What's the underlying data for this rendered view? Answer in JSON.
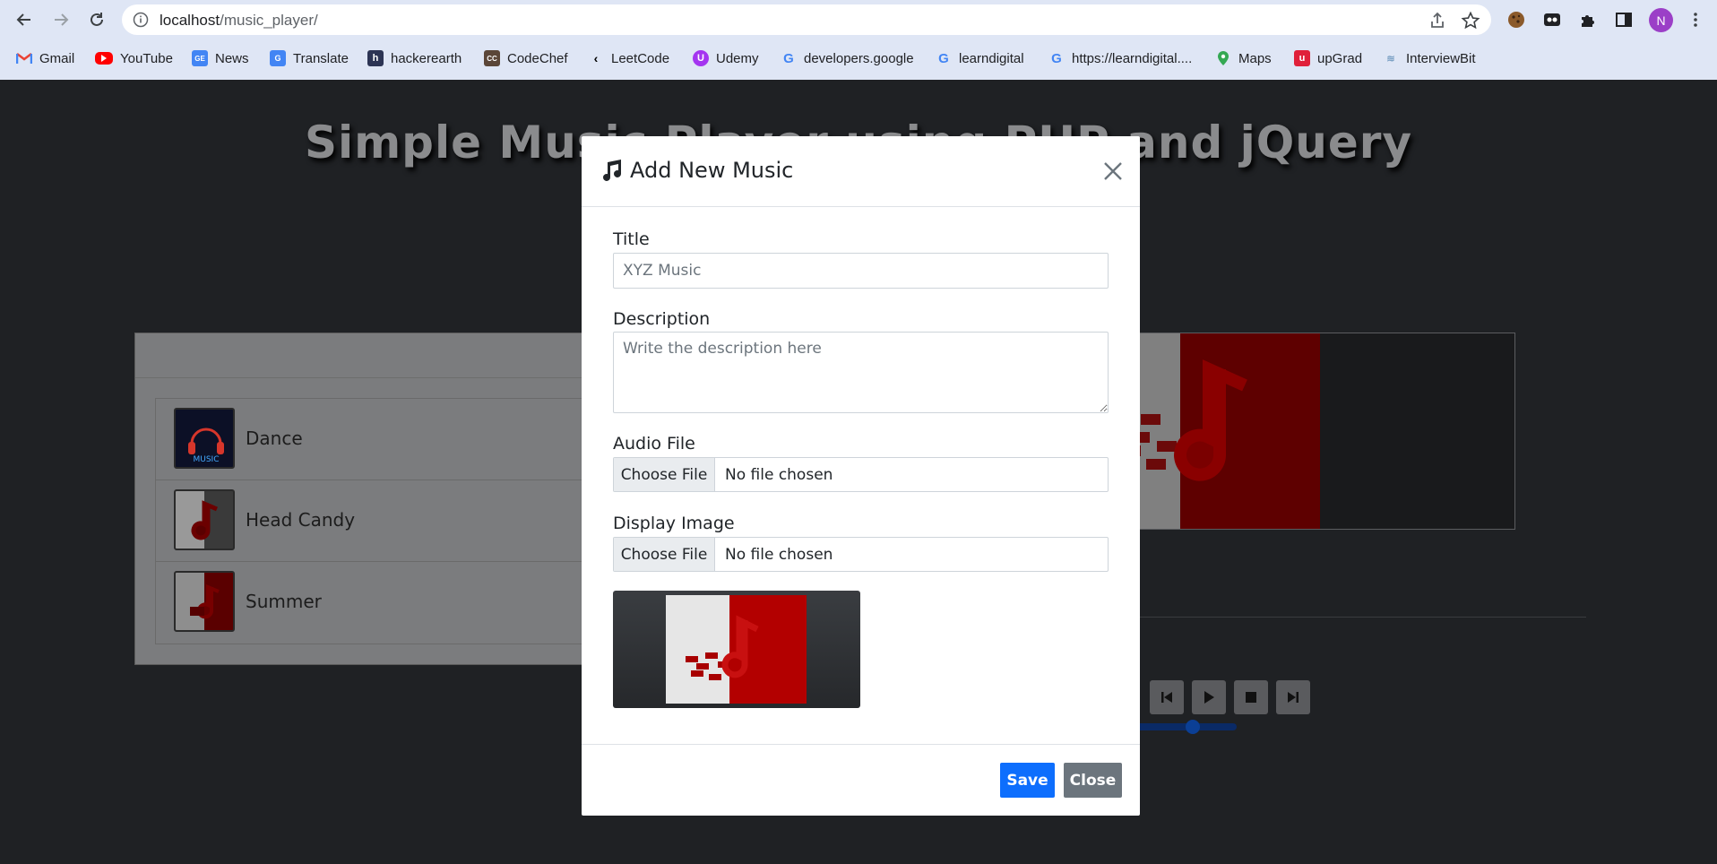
{
  "browser": {
    "url_host": "localhost",
    "url_path": "/music_player/",
    "profile_initial": "N",
    "bookmarks": [
      {
        "label": "Gmail",
        "icon": "gmail-icon"
      },
      {
        "label": "YouTube",
        "icon": "youtube-icon"
      },
      {
        "label": "News",
        "icon": "google-news-icon"
      },
      {
        "label": "Translate",
        "icon": "translate-icon"
      },
      {
        "label": "hackerearth",
        "icon": "hackerearth-icon"
      },
      {
        "label": "CodeChef",
        "icon": "codechef-icon"
      },
      {
        "label": "LeetCode",
        "icon": "leetcode-icon"
      },
      {
        "label": "Udemy",
        "icon": "udemy-icon"
      },
      {
        "label": "developers.google",
        "icon": "google-icon"
      },
      {
        "label": "learndigital",
        "icon": "google-icon"
      },
      {
        "label": "https://learndigital....",
        "icon": "google-icon"
      },
      {
        "label": "Maps",
        "icon": "maps-icon"
      },
      {
        "label": "upGrad",
        "icon": "upgrad-icon"
      },
      {
        "label": "InterviewBit",
        "icon": "interviewbit-icon"
      }
    ]
  },
  "page": {
    "title": "Simple Music Player using PHP and jQuery",
    "tracks": [
      {
        "name": "Dance"
      },
      {
        "name": "Head Candy"
      },
      {
        "name": "Summer"
      }
    ],
    "progress_fraction": 0.67
  },
  "modal": {
    "title": "Add New Music",
    "title_icon": "music-note-icon",
    "title_label": "Title",
    "title_placeholder": "XYZ Music",
    "description_label": "Description",
    "description_placeholder": "Write the description here",
    "audio_label": "Audio File",
    "image_label": "Display Image",
    "choose_file": "Choose File",
    "no_file": "No file chosen",
    "save_label": "Save",
    "close_label": "Close"
  },
  "colors": {
    "primary": "#0d6efd",
    "secondary": "#6c757d",
    "accent_red": "#b30000"
  }
}
